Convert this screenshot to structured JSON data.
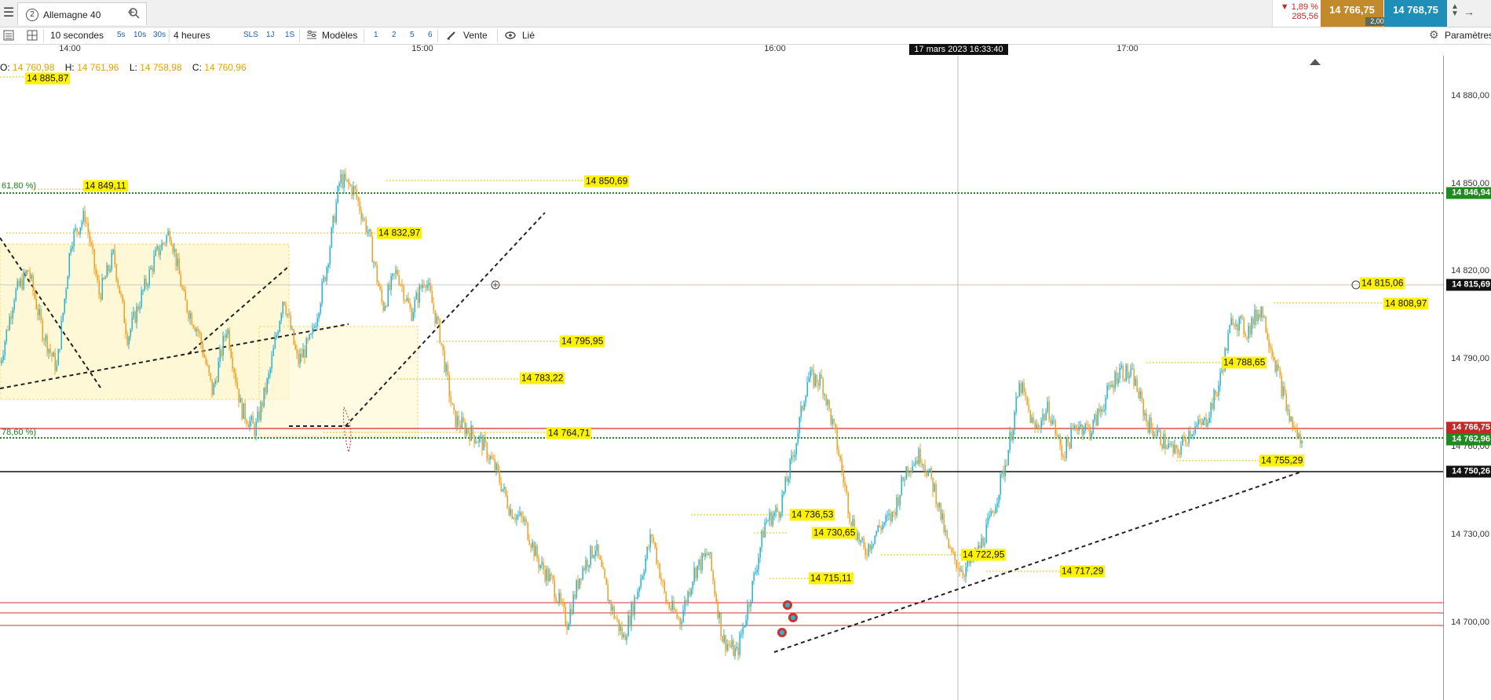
{
  "window": {
    "tab_number": "2",
    "tab_title": "Allemagne 40",
    "change_pct": "▼ 1,89 %",
    "change_pts": "285,56",
    "bid": "14 766,75",
    "ask": "14 768,75",
    "spread": "2,00"
  },
  "toolbar": {
    "interval": "10 secondes",
    "quick_intervals": [
      "5s",
      "10s",
      "30s"
    ],
    "period": "4 heures",
    "period_shortcuts": [
      "SLS",
      "1J",
      "1S"
    ],
    "models_label": "Modèles",
    "layout_numbers": [
      "1",
      "2",
      "5",
      "6"
    ],
    "sell_label": "Vente",
    "linked_label": "Lié",
    "settings_label": "Paramètres"
  },
  "time_axis": {
    "ticks": [
      "14:00",
      "15:00",
      "16:00",
      "17:00"
    ],
    "crosshair_time": "17 mars 2023 16:33:40"
  },
  "ohlc": {
    "o_label": "O:",
    "o": "14 760,98",
    "h_label": "H:",
    "h": "14 761,96",
    "l_label": "L:",
    "l": "14 758,98",
    "c_label": "C:",
    "c": "14 760,96"
  },
  "chart_data": {
    "type": "candlestick",
    "instrument": "Allemagne 40",
    "ylim": [
      14680,
      14890
    ],
    "y_ticks": [
      "14 880,00",
      "14 850,00",
      "14 820,00",
      "14 790,00",
      "14 760,00",
      "14 730,00",
      "14 700,00"
    ],
    "price_path": [
      14790,
      14812,
      14820,
      14800,
      14788,
      14830,
      14838,
      14812,
      14825,
      14798,
      14812,
      14825,
      14833,
      14810,
      14800,
      14780,
      14802,
      14775,
      14768,
      14786,
      14812,
      14790,
      14798,
      14820,
      14850,
      14846,
      14832,
      14808,
      14820,
      14806,
      14818,
      14800,
      14772,
      14768,
      14764,
      14755,
      14742,
      14738,
      14725,
      14718,
      14705,
      14722,
      14730,
      14712,
      14700,
      14716,
      14734,
      14712,
      14706,
      14722,
      14728,
      14700,
      14695,
      14715,
      14738,
      14742,
      14760,
      14785,
      14784,
      14765,
      14740,
      14728,
      14736,
      14740,
      14756,
      14760,
      14748,
      14728,
      14722,
      14728,
      14740,
      14758,
      14783,
      14768,
      14775,
      14760,
      14770,
      14768,
      14778,
      14788,
      14785,
      14770,
      14765,
      14760,
      14768,
      14770,
      14782,
      14805,
      14800,
      14808,
      14790,
      14772,
      14762
    ],
    "price_labels": [
      "14 885,87",
      "14 849,11",
      "14 850,69",
      "14 832,97",
      "14 795,95",
      "14 783,22",
      "14 764,71",
      "14 736,53",
      "14 730,65",
      "14 715,11",
      "14 722,95",
      "14 717,29",
      "14 788,65",
      "14 755,29",
      "14 808,97",
      "14 815,06"
    ],
    "fib_labels": [
      "61,80 %)",
      "78,60 %)"
    ],
    "axis_tags": [
      {
        "value": "14 846,94",
        "color": "#1f8a1f"
      },
      {
        "value": "14 815,69",
        "color": "#111111"
      },
      {
        "value": "14 766,75",
        "color": "#c62828"
      },
      {
        "value": "14 762,96",
        "color": "#1f8a1f"
      },
      {
        "value": "14 750,26",
        "color": "#111111"
      }
    ]
  }
}
